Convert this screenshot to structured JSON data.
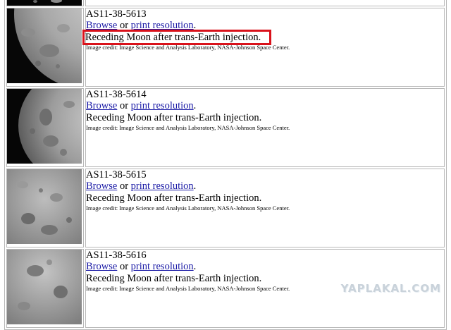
{
  "rows": [
    {
      "id": "",
      "browse": "",
      "or": "",
      "print": "",
      "caption": "",
      "credit": ""
    },
    {
      "id": "AS11-38-5613",
      "browse": "Browse",
      "or": " or ",
      "print": "print resolution",
      "caption": "Receding Moon after trans-Earth injection.",
      "credit": "Image credit: Image Science and Analysis Laboratory, NASA-Johnson Space Center."
    },
    {
      "id": "AS11-38-5614",
      "browse": "Browse",
      "or": " or ",
      "print": "print resolution",
      "caption": "Receding Moon after trans-Earth injection.",
      "credit": "Image credit: Image Science and Analysis Laboratory, NASA-Johnson Space Center."
    },
    {
      "id": "AS11-38-5615",
      "browse": "Browse",
      "or": " or ",
      "print": "print resolution",
      "caption": "Receding Moon after trans-Earth injection.",
      "credit": "Image credit: Image Science and Analysis Laboratory, NASA-Johnson Space Center."
    },
    {
      "id": "AS11-38-5616",
      "browse": "Browse",
      "or": " or ",
      "print": "print resolution",
      "caption": "Receding Moon after trans-Earth injection.",
      "credit": "Image credit: Image Science and Analysis Laboratory, NASA-Johnson Space Center."
    }
  ],
  "punct": {
    "period": "."
  },
  "watermark": "YAPLAKAL.COM",
  "colors": {
    "link": "#1a1aa6",
    "highlight": "#d9121b",
    "border": "#b8b8b8"
  }
}
